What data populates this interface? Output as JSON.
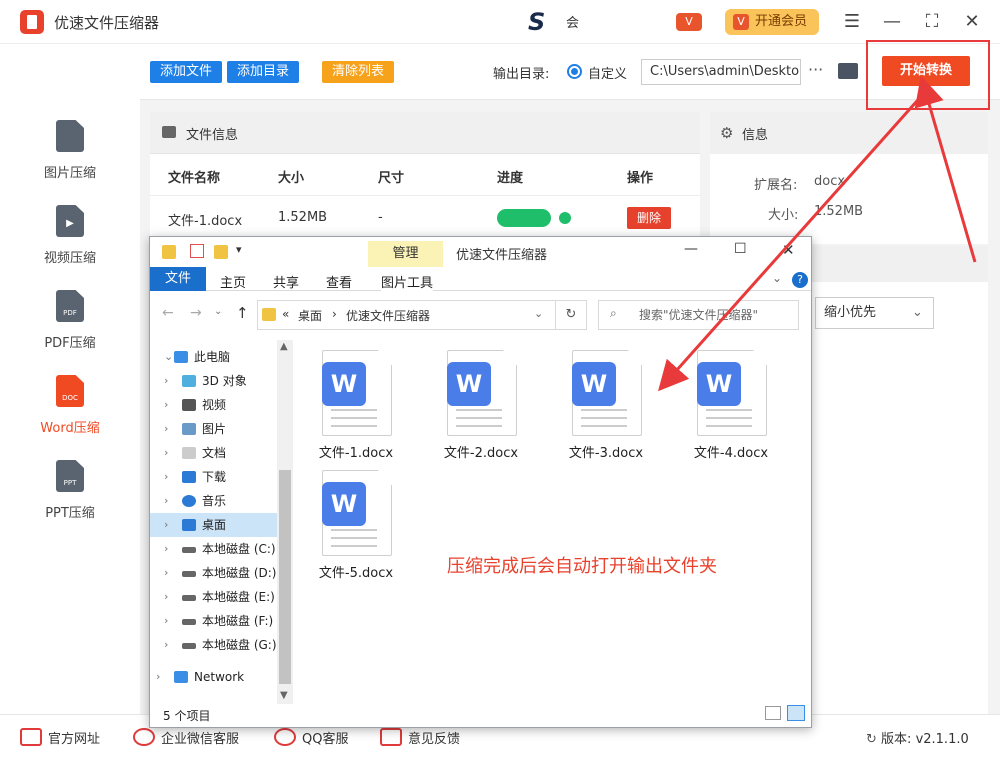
{
  "app": {
    "title": "优速文件压缩器",
    "ad_text": "会"
  },
  "header": {
    "vip_label": "开通会员",
    "vip_mini": "V"
  },
  "sidebar": {
    "items": [
      {
        "label": "图片压缩",
        "badge": ""
      },
      {
        "label": "视频压缩",
        "badge": "▶"
      },
      {
        "label": "PDF压缩",
        "badge": "PDF"
      },
      {
        "label": "Word压缩",
        "badge": "DOC"
      },
      {
        "label": "PPT压缩",
        "badge": "PPT"
      }
    ]
  },
  "toolbar": {
    "add_file": "添加文件",
    "add_dir": "添加目录",
    "clear_list": "清除列表",
    "output_label": "输出目录:",
    "radio_label": "自定义",
    "output_path": "C:\\Users\\admin\\Deskto",
    "more": "···",
    "start": "开始转换"
  },
  "files_panel": {
    "title": "文件信息",
    "columns": [
      "文件名称",
      "大小",
      "尺寸",
      "进度",
      "操作"
    ],
    "rows": [
      {
        "name": "文件-1.docx",
        "size": "1.52MB",
        "dim": "-",
        "progress": 1.0,
        "action": "删除"
      }
    ]
  },
  "info_panel": {
    "title": "信息",
    "ext_label": "扩展名:",
    "ext": "docx",
    "size_label": "大小:",
    "size": "1.52MB"
  },
  "options": {
    "select_value": "缩小优先"
  },
  "footer": {
    "links": [
      "官方网址",
      "企业微信客服",
      "QQ客服",
      "意见反馈"
    ],
    "version_label": "版本:",
    "version": "v2.1.1.0"
  },
  "explorer": {
    "title": "优速文件压缩器",
    "manage_tab": "管理",
    "tabs": [
      "文件",
      "主页",
      "共享",
      "查看",
      "图片工具"
    ],
    "address": [
      "桌面",
      "优速文件压缩器"
    ],
    "search_placeholder": "搜索\"优速文件压缩器\"",
    "tree": [
      "此电脑",
      "3D 对象",
      "视频",
      "图片",
      "文档",
      "下载",
      "音乐",
      "桌面",
      "本地磁盘 (C:)",
      "本地磁盘 (D:)",
      "本地磁盘 (E:)",
      "本地磁盘 (F:)",
      "本地磁盘 (G:)",
      "Network"
    ],
    "files": [
      "文件-1.docx",
      "文件-2.docx",
      "文件-3.docx",
      "文件-4.docx",
      "文件-5.docx"
    ],
    "status": "5 个项目"
  },
  "annotation": {
    "note": "压缩完成后会自动打开输出文件夹"
  },
  "colors": {
    "accent_red": "#f04a23",
    "accent_blue": "#1e7fe6",
    "progress_green": "#1fbe6a"
  }
}
